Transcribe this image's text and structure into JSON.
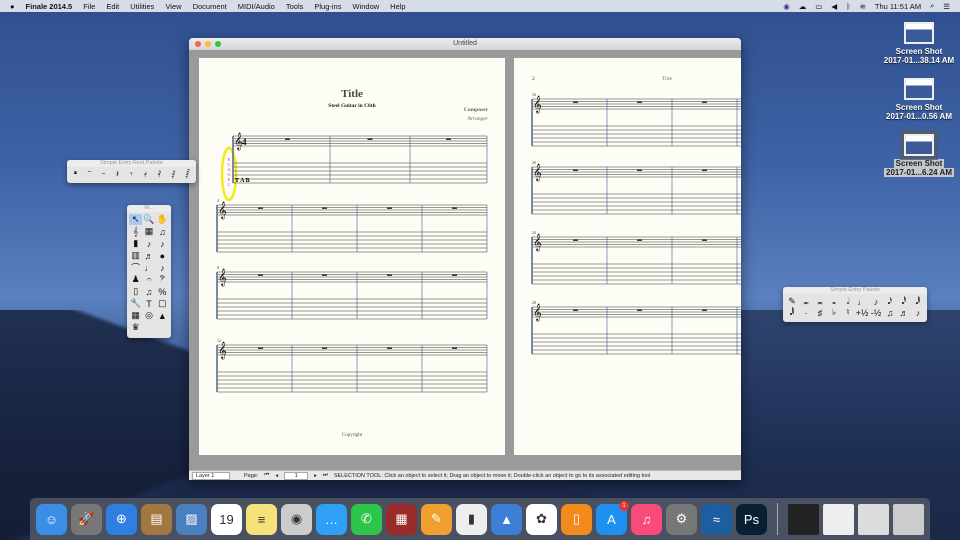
{
  "menubar": {
    "app": "Finale 2014.5",
    "items": [
      "File",
      "Edit",
      "Utilities",
      "View",
      "Document",
      "MIDI/Audio",
      "Tools",
      "Plug-ins",
      "Window",
      "Help"
    ],
    "clock": "Thu 11:51 AM"
  },
  "desktop_icons": [
    {
      "title": "Screen Shot",
      "sub": "2017-01...38.14 AM"
    },
    {
      "title": "Screen Shot",
      "sub": "2017-01...0.56 AM"
    },
    {
      "title": "Screen Shot",
      "sub": "2017-01...6.24 AM"
    }
  ],
  "window": {
    "title": "Untitled"
  },
  "score": {
    "title": "Title",
    "subtitle": "Steel Guitar in C6th",
    "composer": "Composer",
    "arranger": "Arranger",
    "copyright": "Copyright",
    "page2_number": "2",
    "page2_header": "Title",
    "tuning": [
      "E",
      "C",
      "A",
      "G",
      "E",
      "C"
    ],
    "measure_numbers_p1": [
      "4",
      "8",
      "12"
    ],
    "measure_numbers_p2": [
      "16",
      "20",
      "24",
      "28"
    ]
  },
  "statusbar": {
    "layer": "Layer 1",
    "page_label": "Page:",
    "page_value": "1",
    "message": "SELECTION TOOL: Click an object to select it; Drag an object to move it; Double-click an object to go to its associated editing tool"
  },
  "palettes": {
    "rest": {
      "title": "Simple Entry Rest Palette",
      "items": [
        "𝄺",
        "𝄻",
        "𝄼",
        "𝄽",
        "𝄾",
        "𝄿",
        "𝅀",
        "𝅁",
        "𝅂"
      ]
    },
    "main": {
      "title": "M...",
      "items": [
        "↖",
        "🔍",
        "✋",
        "𝄞",
        "▦",
        "♫",
        "▮",
        "♪",
        "♪",
        "▥",
        "♬",
        "●",
        "⌒",
        "♩",
        "♪",
        "♟",
        "𝄐",
        "𝄢",
        "▯",
        "♫",
        "%",
        "🔧",
        "T",
        "▢",
        "▦",
        "◎",
        "▲",
        "♛"
      ]
    },
    "simple": {
      "title": "Simple Entry Palette",
      "items": [
        "✎",
        "𝅜",
        "𝅜",
        "𝅝",
        "𝅗𝅥",
        "♩",
        "♪",
        "𝅘𝅥𝅯",
        "𝅘𝅥𝅰",
        "𝅘𝅥𝅱",
        "𝅘𝅥𝅲",
        "·",
        "♯",
        "♭",
        "♮",
        "+½",
        "-½",
        "♫",
        "♬",
        "♪"
      ]
    }
  },
  "dock": [
    {
      "name": "finder",
      "g": "☺",
      "c": "#3a8ee6"
    },
    {
      "name": "launchpad",
      "g": "🚀",
      "c": "#777"
    },
    {
      "name": "safari",
      "g": "⊕",
      "c": "#2f7fe0"
    },
    {
      "name": "contacts",
      "g": "▤",
      "c": "#a07840"
    },
    {
      "name": "preview",
      "g": "▨",
      "c": "#4a7fc0"
    },
    {
      "name": "calendar",
      "g": "19",
      "c": "#fff"
    },
    {
      "name": "notes",
      "g": "≡",
      "c": "#f5e27a"
    },
    {
      "name": "photo-booth",
      "g": "◉",
      "c": "#ccc"
    },
    {
      "name": "messages",
      "g": "…",
      "c": "#2ea0f5"
    },
    {
      "name": "facetime",
      "g": "✆",
      "c": "#2dc64b"
    },
    {
      "name": "photo-booth-2",
      "g": "▦",
      "c": "#9b2a2a"
    },
    {
      "name": "pages",
      "g": "✎",
      "c": "#f0a030"
    },
    {
      "name": "numbers",
      "g": "▮",
      "c": "#eee"
    },
    {
      "name": "keynote",
      "g": "▲",
      "c": "#3b80d6"
    },
    {
      "name": "photos",
      "g": "✿",
      "c": "#fff"
    },
    {
      "name": "ibooks",
      "g": "▯",
      "c": "#f28a1c"
    },
    {
      "name": "app-store",
      "g": "A",
      "c": "#1e90f0",
      "badge": "1"
    },
    {
      "name": "itunes",
      "g": "♫",
      "c": "#fa4a7a"
    },
    {
      "name": "system-preferences",
      "g": "⚙",
      "c": "#777"
    },
    {
      "name": "finale",
      "g": "≈",
      "c": "#1c5ea0"
    },
    {
      "name": "photoshop",
      "g": "Ps",
      "c": "#0a1f33"
    }
  ],
  "dock_right": [
    {
      "name": "doc-1",
      "c": "#222"
    },
    {
      "name": "doc-2",
      "c": "#eee"
    },
    {
      "name": "doc-3",
      "c": "#ddd"
    },
    {
      "name": "trash",
      "c": "#ccc"
    }
  ]
}
